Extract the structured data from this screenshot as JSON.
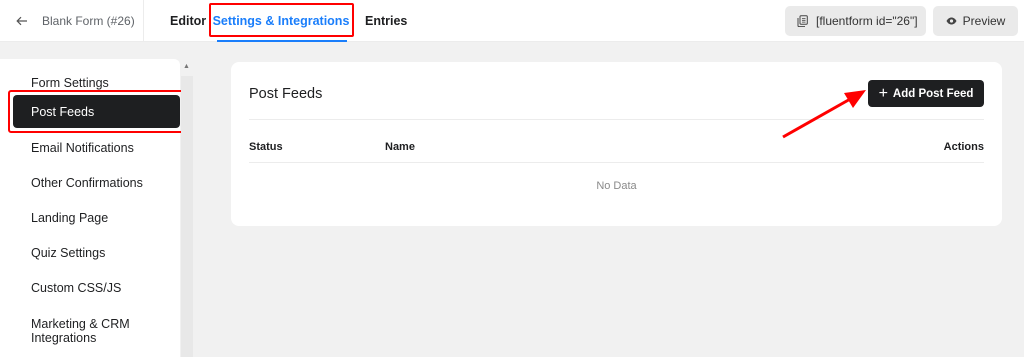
{
  "header": {
    "back_icon": "arrow-left-icon",
    "form_title": "Blank Form (#26)",
    "tabs": [
      {
        "label": "Editor",
        "active": false
      },
      {
        "label": "Settings & Integrations",
        "active": true
      },
      {
        "label": "Entries",
        "active": false
      }
    ],
    "shortcode": {
      "icon": "copy-icon",
      "label": "[fluentform id=\"26\"]"
    },
    "preview": {
      "icon": "eye-icon",
      "label": "Preview"
    }
  },
  "sidebar": {
    "items": [
      {
        "label": "Form Settings",
        "active": false
      },
      {
        "label": "Post Feeds",
        "active": true
      },
      {
        "label": "Email Notifications",
        "active": false
      },
      {
        "label": "Other Confirmations",
        "active": false
      },
      {
        "label": "Landing Page",
        "active": false
      },
      {
        "label": "Quiz Settings",
        "active": false
      },
      {
        "label": "Custom CSS/JS",
        "active": false
      },
      {
        "label": "Marketing & CRM Integrations",
        "active": false
      }
    ]
  },
  "main": {
    "title": "Post Feeds",
    "add_button": {
      "icon": "plus-icon",
      "symbol": "+",
      "label": "Add Post Feed"
    },
    "table": {
      "columns": [
        "Status",
        "Name",
        "Actions"
      ],
      "rows": [],
      "empty_text": "No Data"
    }
  },
  "colors": {
    "accent": "#1a7efb",
    "dark": "#1e1f21",
    "annotation": "#ff0000",
    "background": "#f1f1f1"
  }
}
